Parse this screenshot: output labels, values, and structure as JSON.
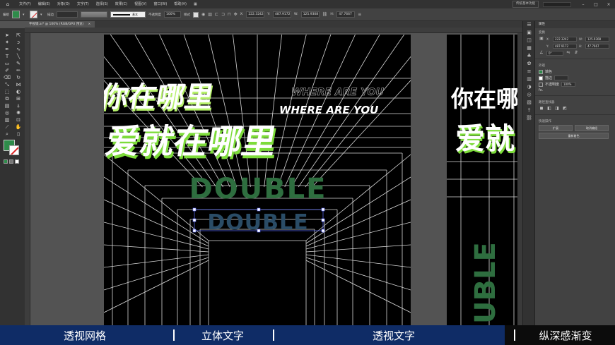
{
  "menubar": {
    "items": [
      "编辑",
      "文件(F)",
      "编辑(E)",
      "对象(O)",
      "文字(T)",
      "选择(S)",
      "效果(C)",
      "视图(V)",
      "窗口(W)",
      "帮助(H)"
    ],
    "workspace": "传统基本功能"
  },
  "control": {
    "selection_label": "编组",
    "stroke_label": "描边",
    "style_label": "基本",
    "opacity_label": "不透明度",
    "opacity_value": "100%",
    "style_text": "样式",
    "x_value": "222.3242",
    "y_value": "487.9172",
    "w_value": "125.9308",
    "h_value": "47.7667"
  },
  "document_tab": {
    "title": "字视镜.ai* @ 100% (RGB/GPU 预览)",
    "close": "×"
  },
  "properties": {
    "panel_title": "属性",
    "sec_transform": "变换",
    "x": "222.3242",
    "y": "487.9172",
    "w": "125.9308",
    "h": "47.7667",
    "angle": "0°",
    "sec_appearance": "外观",
    "fill_label": "填色",
    "stroke_label": "描边",
    "opacity_label": "不透明度",
    "opacity_value": "100%",
    "fx": "fx.",
    "sec_path": "路径查找器",
    "sec_quick": "快速操作",
    "btn_expand": "扩展",
    "btn_ungroup": "取消编组",
    "btn_recolor": "重新着色"
  },
  "artwork": {
    "cn_line1": "你在哪里",
    "cn_line2": "爱就在哪里",
    "en_line": "WHERE ARE YOU",
    "en_line_ghost": "WHERE ARE YOU",
    "word1": "DOUBLE",
    "word2": "DOUBLE",
    "artboard2_cn1": "你在哪",
    "artboard2_cn2": "爱就",
    "artboard2_vertical": "UBLE"
  },
  "subtitles": [
    "透视网格",
    "立体文字",
    "透视文字",
    "纵深感渐变"
  ],
  "colors": {
    "accent_green": "#2e8b4a",
    "text_green": "#7ddc3a",
    "subtitle_bg": "#0f2c66",
    "double_blue": "#2a4c66",
    "grid": "#d8d8d8"
  }
}
